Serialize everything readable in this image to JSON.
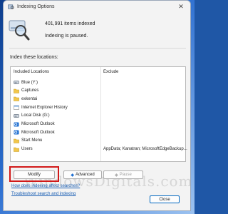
{
  "window": {
    "title": "Indexing Options",
    "close_glyph": "✕"
  },
  "summary": {
    "items_indexed": "401,991 items indexed",
    "status": "Indexing is paused."
  },
  "locations_label": "Index these locations:",
  "columns": {
    "included": "Included Locations",
    "exclude": "Exclude"
  },
  "locations": [
    {
      "icon": "drive-icon",
      "label": "Blue (Y:)",
      "exclude": ""
    },
    {
      "icon": "folder-icon",
      "label": "Captures",
      "exclude": ""
    },
    {
      "icon": "folder-icon",
      "label": "exkentai",
      "exclude": ""
    },
    {
      "icon": "ie-history-icon",
      "label": "Internet Explorer History",
      "exclude": ""
    },
    {
      "icon": "drive-icon",
      "label": "Local Disk (G:)",
      "exclude": ""
    },
    {
      "icon": "outlook-icon",
      "label": "Microsoft Outlook",
      "exclude": ""
    },
    {
      "icon": "outlook-icon",
      "label": "Microsoft Outlook",
      "exclude": ""
    },
    {
      "icon": "folder-icon",
      "label": "Start Menu",
      "exclude": ""
    },
    {
      "icon": "folder-icon",
      "label": "Users",
      "exclude": "AppData; Kanatran; MicrosoftEdgeBackup..."
    }
  ],
  "watermark": "WindowsDigitals.com",
  "buttons": {
    "modify": "Modify",
    "advanced": "Advanced",
    "pause": "Pause",
    "close": "Close"
  },
  "links": {
    "how_affect": "How does indexing affect searches?",
    "troubleshoot": "Troubleshoot search and indexing"
  }
}
